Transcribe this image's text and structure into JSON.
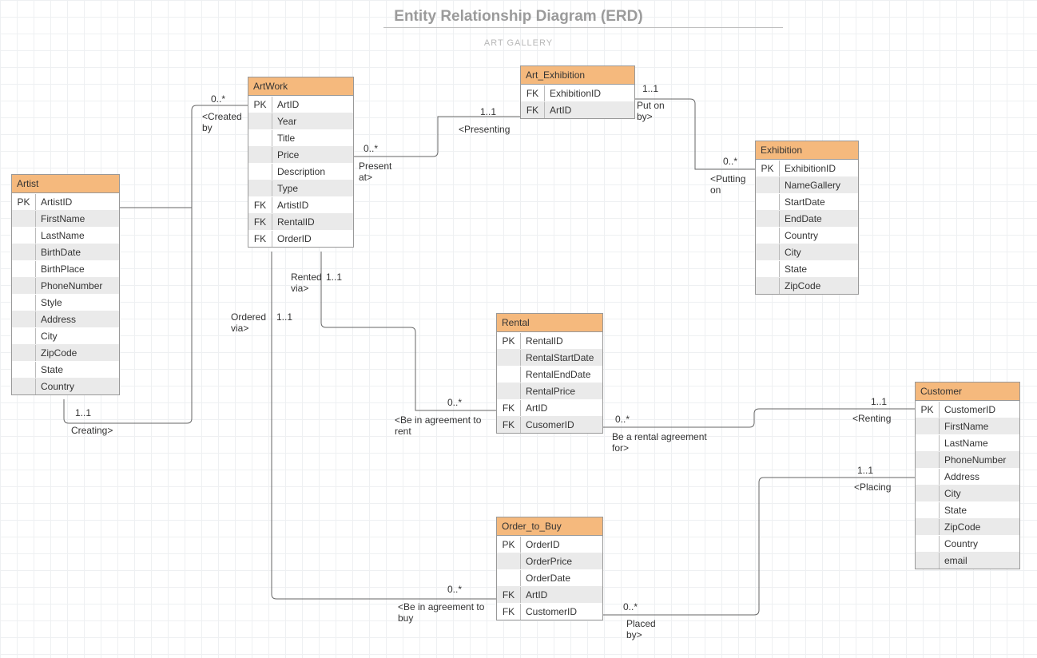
{
  "header": {
    "title": "Entity Relationship Diagram (ERD)",
    "subtitle": "ART GALLERY"
  },
  "entities": {
    "artist": {
      "name": "Artist",
      "rows": [
        {
          "key": "PK",
          "field": "ArtistID"
        },
        {
          "key": "",
          "field": "FirstName"
        },
        {
          "key": "",
          "field": "LastName"
        },
        {
          "key": "",
          "field": "BirthDate"
        },
        {
          "key": "",
          "field": "BirthPlace"
        },
        {
          "key": "",
          "field": "PhoneNumber"
        },
        {
          "key": "",
          "field": "Style"
        },
        {
          "key": "",
          "field": "Address"
        },
        {
          "key": "",
          "field": "City"
        },
        {
          "key": "",
          "field": "ZipCode"
        },
        {
          "key": "",
          "field": "State"
        },
        {
          "key": "",
          "field": "Country"
        }
      ]
    },
    "artwork": {
      "name": "ArtWork",
      "rows": [
        {
          "key": "PK",
          "field": "ArtID"
        },
        {
          "key": "",
          "field": "Year"
        },
        {
          "key": "",
          "field": "Title"
        },
        {
          "key": "",
          "field": "Price"
        },
        {
          "key": "",
          "field": "Description"
        },
        {
          "key": "",
          "field": "Type"
        },
        {
          "key": "FK",
          "field": "ArtistID"
        },
        {
          "key": "FK",
          "field": "RentalID"
        },
        {
          "key": "FK",
          "field": "OrderID"
        }
      ]
    },
    "art_exhibition": {
      "name": "Art_Exhibition",
      "rows": [
        {
          "key": "FK",
          "field": "ExhibitionID"
        },
        {
          "key": "FK",
          "field": "ArtID"
        }
      ]
    },
    "exhibition": {
      "name": "Exhibition",
      "rows": [
        {
          "key": "PK",
          "field": "ExhibitionID"
        },
        {
          "key": "",
          "field": "NameGallery"
        },
        {
          "key": "",
          "field": "StartDate"
        },
        {
          "key": "",
          "field": "EndDate"
        },
        {
          "key": "",
          "field": "Country"
        },
        {
          "key": "",
          "field": "City"
        },
        {
          "key": "",
          "field": "State"
        },
        {
          "key": "",
          "field": "ZipCode"
        }
      ]
    },
    "rental": {
      "name": "Rental",
      "rows": [
        {
          "key": "PK",
          "field": "RentalID"
        },
        {
          "key": "",
          "field": "RentalStartDate"
        },
        {
          "key": "",
          "field": "RentalEndDate"
        },
        {
          "key": "",
          "field": "RentalPrice"
        },
        {
          "key": "FK",
          "field": "ArtID"
        },
        {
          "key": "FK",
          "field": "CusomerID"
        }
      ]
    },
    "order": {
      "name": "Order_to_Buy",
      "rows": [
        {
          "key": "PK",
          "field": "OrderID"
        },
        {
          "key": "",
          "field": "OrderPrice"
        },
        {
          "key": "",
          "field": "OrderDate"
        },
        {
          "key": "FK",
          "field": "ArtID"
        },
        {
          "key": "FK",
          "field": "CustomerID"
        }
      ]
    },
    "customer": {
      "name": "Customer",
      "rows": [
        {
          "key": "PK",
          "field": "CustomerID"
        },
        {
          "key": "",
          "field": "FirstName"
        },
        {
          "key": "",
          "field": "LastName"
        },
        {
          "key": "",
          "field": "PhoneNumber"
        },
        {
          "key": "",
          "field": "Address"
        },
        {
          "key": "",
          "field": "City"
        },
        {
          "key": "",
          "field": "State"
        },
        {
          "key": "",
          "field": "ZipCode"
        },
        {
          "key": "",
          "field": "Country"
        },
        {
          "key": "",
          "field": "email"
        }
      ]
    }
  },
  "labels": {
    "created_by_card": "0..*",
    "created_by_text": "<Created\nby",
    "creating_card": "1..1",
    "creating_text": "Creating>",
    "present_at_card": "0..*",
    "present_at_text": "Present\nat>",
    "presenting_card": "1..1",
    "presenting_text": "<Presenting",
    "puton_by_card": "1..1",
    "puton_by_text": "Put on\nby>",
    "putting_on_card": "0..*",
    "putting_on_text": "<Putting\non",
    "rented_via_card": "1..1",
    "rented_via_text": "Rented\nvia>",
    "ordered_via_card": "1..1",
    "ordered_via_text": "Ordered\nvia>",
    "agree_rent_card": "0..*",
    "agree_rent_text": "<Be in agreement to\nrent",
    "rental_for_card": "0..*",
    "rental_for_text": "Be a rental agreement\nfor>",
    "renting_card": "1..1",
    "renting_text": "<Renting",
    "agree_buy_card": "0..*",
    "agree_buy_text": "<Be in agreement to\nbuy",
    "placed_by_card": "0..*",
    "placed_by_text": "Placed\nby>",
    "placing_card": "1..1",
    "placing_text": "<Placing"
  }
}
